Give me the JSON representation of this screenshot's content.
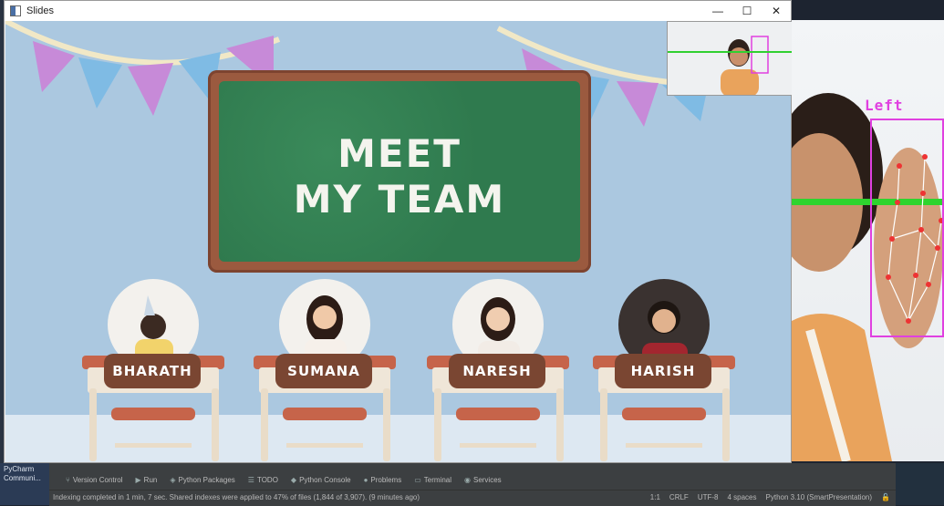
{
  "window": {
    "title": "Slides",
    "minimize": "—",
    "maximize": "☐",
    "close": "✕"
  },
  "slide": {
    "heading_line1": "MEET",
    "heading_line2": "MY TEAM",
    "members": [
      {
        "name": "BHARATH"
      },
      {
        "name": "SUMANA"
      },
      {
        "name": "NARESH"
      },
      {
        "name": "HARISH"
      }
    ]
  },
  "webcam": {
    "hand_label": "Left"
  },
  "taskbar": {
    "app_tile": [
      "PyCharm",
      "Communi..."
    ]
  },
  "ide": {
    "tool_tabs": [
      {
        "icon": "version-control-icon",
        "label": "Version Control"
      },
      {
        "icon": "run-icon",
        "label": "Run"
      },
      {
        "icon": "python-packages-icon",
        "label": "Python Packages"
      },
      {
        "icon": "todo-icon",
        "label": "TODO"
      },
      {
        "icon": "python-console-icon",
        "label": "Python Console"
      },
      {
        "icon": "problems-icon",
        "label": "Problems"
      },
      {
        "icon": "terminal-icon",
        "label": "Terminal"
      },
      {
        "icon": "services-icon",
        "label": "Services"
      }
    ],
    "status_message": "Indexing completed in 1 min, 7 sec. Shared indexes were applied to 47% of files (1,844 of 3,907). (9 minutes ago)",
    "position": "1:1",
    "line_sep": "CRLF",
    "encoding": "UTF-8",
    "indent": "4 spaces",
    "interpreter": "Python 3.10 (SmartPresentation)"
  }
}
